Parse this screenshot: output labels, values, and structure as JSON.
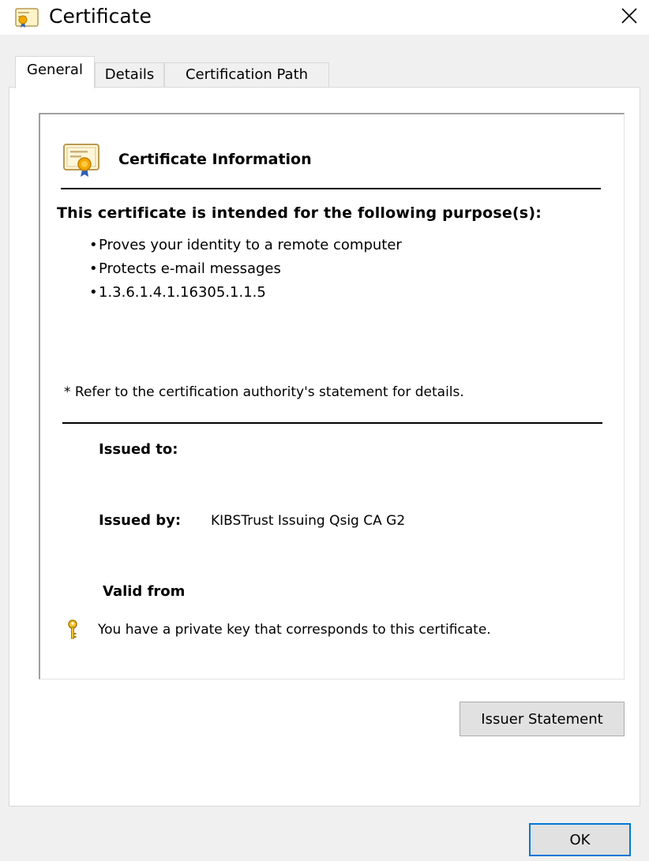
{
  "window": {
    "title": "Certificate",
    "icon": "certificate-icon",
    "close_icon": "close-icon"
  },
  "tabs": [
    {
      "label": "General",
      "active": true
    },
    {
      "label": "Details",
      "active": false
    },
    {
      "label": "Certification Path",
      "active": false
    }
  ],
  "general": {
    "heading": "Certificate Information",
    "purpose_heading": "This certificate is intended for the following purpose(s):",
    "purposes": [
      "Proves your identity to a remote computer",
      "Protects e-mail messages",
      "1.3.6.1.4.1.16305.1.1.5"
    ],
    "refer_note": "* Refer to the certification authority's statement for details.",
    "issued_to_label": "Issued to:",
    "issued_to_value": "",
    "issued_by_label": "Issued by:",
    "issued_by_value": "KIBSTrust Issuing Qsig CA G2",
    "valid_from_label": "Valid from",
    "private_key_note": "You have a private key that corresponds to this certificate.",
    "key_icon": "key-icon"
  },
  "buttons": {
    "issuer_statement": "Issuer Statement",
    "ok": "OK"
  },
  "colors": {
    "accent": "#0078d7",
    "dialog_bg": "#f0f0f0",
    "panel_bg": "#ffffff"
  }
}
